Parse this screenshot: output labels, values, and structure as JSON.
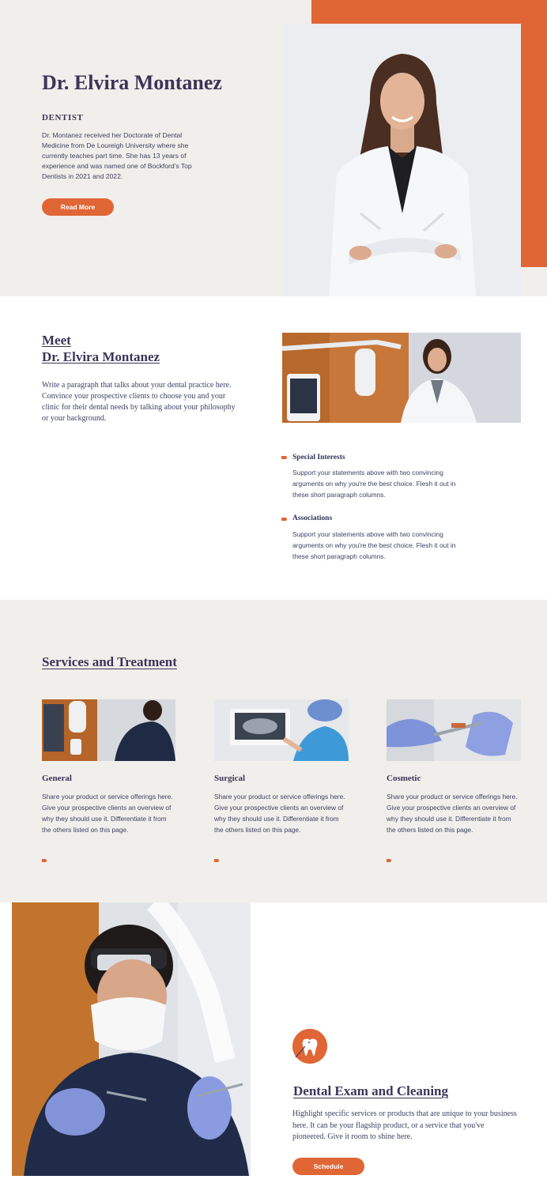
{
  "hero": {
    "name": "Dr. Elvira Montanez",
    "role": "DENTIST",
    "bio": "Dr. Montanez received her Doctorate of Dental Medicine from De Loureigh University where she currently teaches part time. She has 13 years of experience and was named one of Bockford's Top Dentists in 2021 and 2022.",
    "button_label": "Read More"
  },
  "meet": {
    "title_line1": "Meet",
    "title_line2": "Dr. Elvira Montanez",
    "paragraph": "Write a paragraph that talks about your dental practice here. Convince your prospective clients to choose you and your clinic for their dental needs by talking about your philosophy or your background.",
    "features": [
      {
        "title": "Special Interests",
        "text": "Support your statements above with two convincing arguments on why you're the best choice. Flesh it out in these short paragraph columns."
      },
      {
        "title": "Associations",
        "text": "Support your statements above with two convincing arguments on why you're the best choice. Flesh it out in these short paragraph columns."
      }
    ]
  },
  "services": {
    "title": "Services and Treatment",
    "items": [
      {
        "title": "General",
        "text": "Share your product or service offerings here. Give your prospective clients an overview of why they should use it. Differentiate it from the others listed on this page."
      },
      {
        "title": "Surgical",
        "text": "Share your product or service offerings here. Give your prospective clients an overview of why they should use it. Differentiate it from the others listed on this page."
      },
      {
        "title": "Cosmetic",
        "text": "Share your product or service offerings here. Give your prospective clients an overview of why they should use it. Differentiate it from the others listed on this page."
      }
    ]
  },
  "exam": {
    "icon": "tooth-icon",
    "title": "Dental Exam and Cleaning",
    "text": "Highlight specific services or products that are unique to your business here. It can be your flagship product, or a service that you've pioneered. Give it room to shine here.",
    "button_label": "Schedule"
  },
  "colors": {
    "accent": "#e06636",
    "beige": "#f1efeb",
    "text": "#3a3558"
  }
}
